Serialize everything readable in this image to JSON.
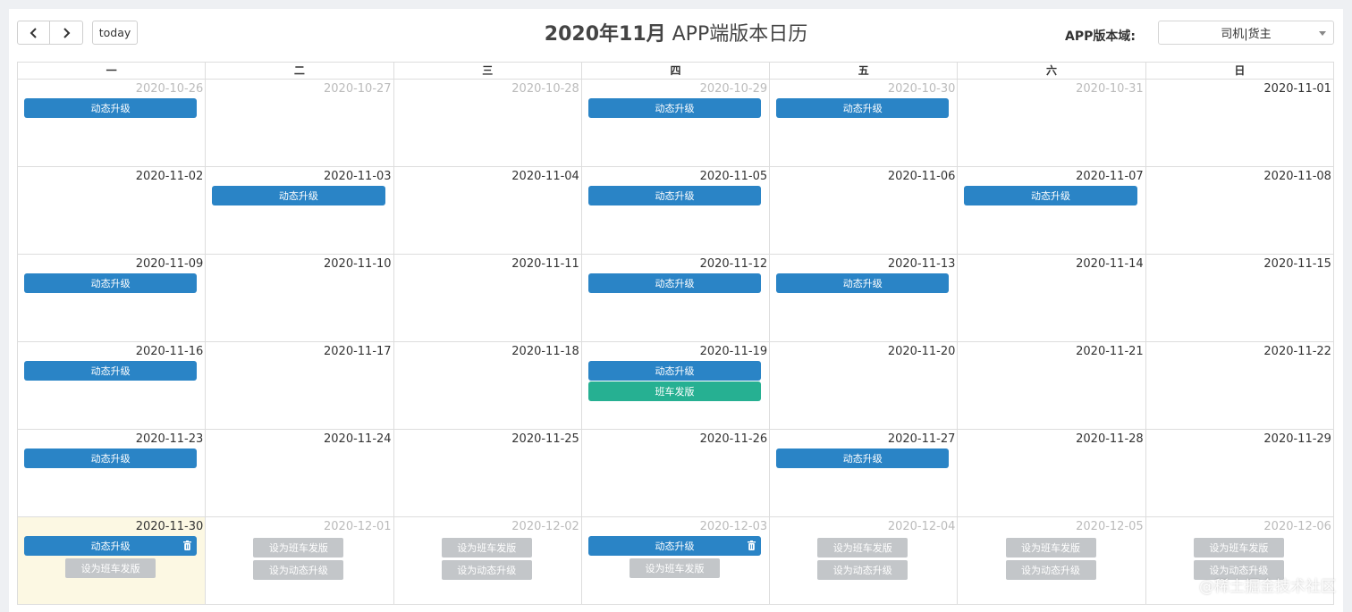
{
  "toolbar": {
    "prev_icon": "chevron-left-icon",
    "next_icon": "chevron-right-icon",
    "today_label": "today",
    "title_bold": "2020年11月",
    "title_rest": " APP端版本日历",
    "domain_label": "APP版本域:",
    "domain_selected": "司机|货主"
  },
  "colors": {
    "event_blue": "#2a84c6",
    "event_green": "#26b092",
    "ghost_button": "#c3c6c9",
    "today_bg": "#fcf8e3"
  },
  "weekdays": [
    "一",
    "二",
    "三",
    "四",
    "五",
    "六",
    "日"
  ],
  "weeks": [
    [
      {
        "date": "2020-10-26",
        "other": true,
        "events": [
          {
            "label": "动态升级",
            "color": "blue"
          }
        ]
      },
      {
        "date": "2020-10-27",
        "other": true,
        "events": []
      },
      {
        "date": "2020-10-28",
        "other": true,
        "events": []
      },
      {
        "date": "2020-10-29",
        "other": true,
        "events": [
          {
            "label": "动态升级",
            "color": "blue"
          }
        ]
      },
      {
        "date": "2020-10-30",
        "other": true,
        "events": [
          {
            "label": "动态升级",
            "color": "blue"
          }
        ]
      },
      {
        "date": "2020-10-31",
        "other": true,
        "events": []
      },
      {
        "date": "2020-11-01",
        "events": []
      }
    ],
    [
      {
        "date": "2020-11-02",
        "events": []
      },
      {
        "date": "2020-11-03",
        "events": [
          {
            "label": "动态升级",
            "color": "blue"
          }
        ]
      },
      {
        "date": "2020-11-04",
        "events": []
      },
      {
        "date": "2020-11-05",
        "events": [
          {
            "label": "动态升级",
            "color": "blue"
          }
        ]
      },
      {
        "date": "2020-11-06",
        "events": []
      },
      {
        "date": "2020-11-07",
        "events": [
          {
            "label": "动态升级",
            "color": "blue"
          }
        ]
      },
      {
        "date": "2020-11-08",
        "events": []
      }
    ],
    [
      {
        "date": "2020-11-09",
        "events": [
          {
            "label": "动态升级",
            "color": "blue"
          }
        ]
      },
      {
        "date": "2020-11-10",
        "events": []
      },
      {
        "date": "2020-11-11",
        "events": []
      },
      {
        "date": "2020-11-12",
        "events": [
          {
            "label": "动态升级",
            "color": "blue"
          }
        ]
      },
      {
        "date": "2020-11-13",
        "events": [
          {
            "label": "动态升级",
            "color": "blue"
          }
        ]
      },
      {
        "date": "2020-11-14",
        "events": []
      },
      {
        "date": "2020-11-15",
        "events": []
      }
    ],
    [
      {
        "date": "2020-11-16",
        "events": [
          {
            "label": "动态升级",
            "color": "blue"
          }
        ]
      },
      {
        "date": "2020-11-17",
        "events": []
      },
      {
        "date": "2020-11-18",
        "events": []
      },
      {
        "date": "2020-11-19",
        "events": [
          {
            "label": "动态升级",
            "color": "blue"
          },
          {
            "label": "班车发版",
            "color": "green"
          }
        ]
      },
      {
        "date": "2020-11-20",
        "events": []
      },
      {
        "date": "2020-11-21",
        "events": []
      },
      {
        "date": "2020-11-22",
        "events": []
      }
    ],
    [
      {
        "date": "2020-11-23",
        "events": [
          {
            "label": "动态升级",
            "color": "blue"
          }
        ]
      },
      {
        "date": "2020-11-24",
        "events": []
      },
      {
        "date": "2020-11-25",
        "events": []
      },
      {
        "date": "2020-11-26",
        "events": []
      },
      {
        "date": "2020-11-27",
        "events": [
          {
            "label": "动态升级",
            "color": "blue"
          }
        ]
      },
      {
        "date": "2020-11-28",
        "events": []
      },
      {
        "date": "2020-11-29",
        "events": []
      }
    ],
    [
      {
        "date": "2020-11-30",
        "today": true,
        "events": [
          {
            "label": "动态升级",
            "color": "blue",
            "trash": true
          }
        ],
        "actions": [
          "设为班车发版"
        ]
      },
      {
        "date": "2020-12-01",
        "other": true,
        "events": [],
        "actions": [
          "设为班车发版",
          "设为动态升级"
        ]
      },
      {
        "date": "2020-12-02",
        "other": true,
        "events": [],
        "actions": [
          "设为班车发版",
          "设为动态升级"
        ]
      },
      {
        "date": "2020-12-03",
        "other": true,
        "events": [
          {
            "label": "动态升级",
            "color": "blue",
            "trash": true
          }
        ],
        "actions": [
          "设为班车发版"
        ]
      },
      {
        "date": "2020-12-04",
        "other": true,
        "events": [],
        "actions": [
          "设为班车发版",
          "设为动态升级"
        ]
      },
      {
        "date": "2020-12-05",
        "other": true,
        "events": [],
        "actions": [
          "设为班车发版",
          "设为动态升级"
        ]
      },
      {
        "date": "2020-12-06",
        "other": true,
        "events": [],
        "actions": [
          "设为班车发版",
          "设为动态升级"
        ]
      }
    ]
  ],
  "watermark": "@稀土掘金技术社区"
}
